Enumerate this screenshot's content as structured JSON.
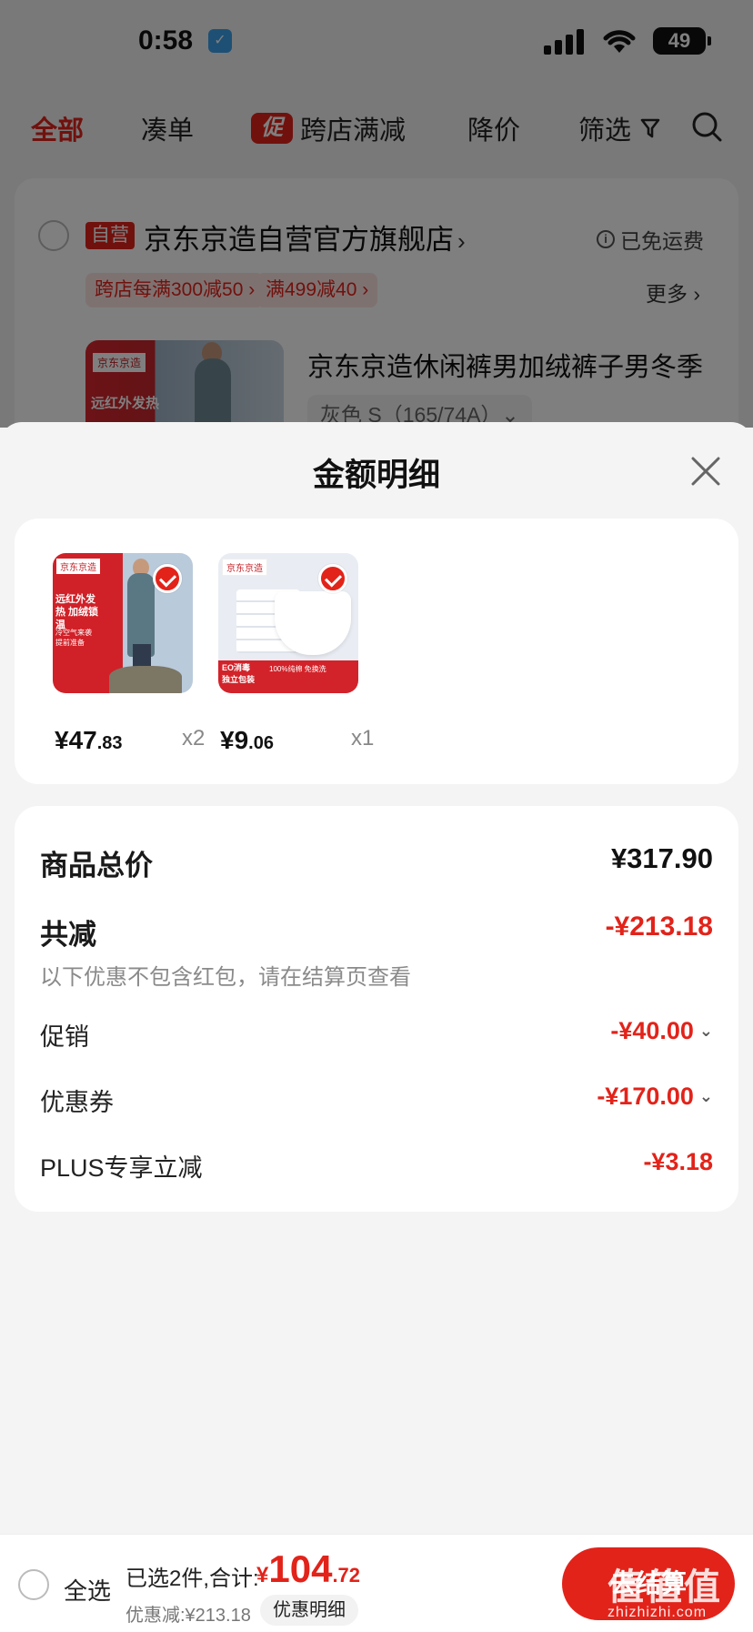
{
  "status_bar": {
    "time": "0:58",
    "battery": "49"
  },
  "top_tabs": {
    "all": "全部",
    "coudan": "凑单",
    "cross_badge": "促",
    "cross": "跨店满减",
    "price_drop": "降价",
    "filter": "筛选"
  },
  "shop": {
    "badge": "自营",
    "name": "京东京造自营官方旗舰店",
    "free_shipping": "已免运费",
    "promo_tags": [
      "跨店每满300减50 ›",
      "满499减40 ›"
    ],
    "more": "更多 ›",
    "product_title": "京东京造休闲裤男加绒裤子男冬季",
    "sku": "灰色   S（165/74A）⌄",
    "thumb_brand": "京东京造",
    "thumb_tag": "远红外发热"
  },
  "sheet": {
    "title": "金额明细",
    "items": [
      {
        "brand": "京东京造",
        "price_int": "¥47",
        "price_dec": ".83",
        "qty": "x2",
        "tag1": "远红外发热 加绒锁温",
        "tag2": "冷空气来袭 提前准备"
      },
      {
        "brand": "京东京造",
        "price_int": "¥9",
        "price_dec": ".06",
        "qty": "x1",
        "band_left": "EO消毒 独立包装",
        "band_right": "100%纯棉 免换洗"
      }
    ],
    "summary": {
      "total_label": "商品总价",
      "total_value": "¥317.90",
      "reduce_label": "共减",
      "reduce_value": "-¥213.18",
      "note": "以下优惠不包含红包，请在结算页查看",
      "promo_label": "促销",
      "promo_value": "-¥40.00",
      "coupon_label": "优惠券",
      "coupon_value": "-¥170.00",
      "plus_label": "PLUS专享立减",
      "plus_value": "-¥3.18"
    }
  },
  "bottom_bar": {
    "select_all": "全选",
    "selected": "已选2件,合计:",
    "total_sym": "¥",
    "total_int": "104",
    "total_dec": ".72",
    "discount": "优惠减:¥213.18",
    "detail_button": "优惠明细",
    "checkout": "去结算",
    "watermark": "值值值",
    "watermark_sub": "zhizhizhi.com"
  },
  "colors": {
    "accent": "#e2231a",
    "background": "#f4f4f4"
  }
}
